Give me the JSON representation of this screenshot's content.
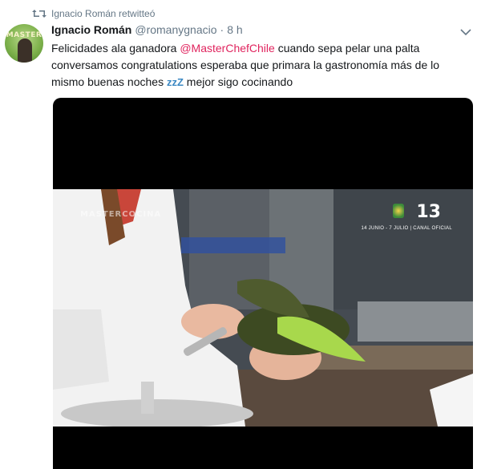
{
  "retweet": {
    "label": "Ignacio Román retwitteó",
    "icon": "retweet-icon"
  },
  "author": {
    "name": "Ignacio Román",
    "handle": "@romanygnacio",
    "separator": "·",
    "time": "8 h",
    "avatar_text": "MASTER"
  },
  "tweet": {
    "text_before_mention": "Felicidades ala ganadora ",
    "mention": "@MasterChefChile",
    "text_after_mention": "  cuando sepa pelar una palta conversamos congratulations esperaba que primara la gastronomía más de lo mismo buenas noches ",
    "zz_emoji": "zzZ",
    "text_end": " mejor sigo cocinando"
  },
  "media": {
    "watermark": "MASTERCOCINA",
    "channel_logo": "13",
    "channel_sub": "14 JUNIO - 7 JULIO | CANAL OFICIAL"
  },
  "colors": {
    "mention": "#e0245e",
    "secondary_text": "#657786",
    "primary_text": "#14171a"
  },
  "icons": {
    "retweet": "retweet-icon",
    "caret": "chevron-down-icon"
  }
}
